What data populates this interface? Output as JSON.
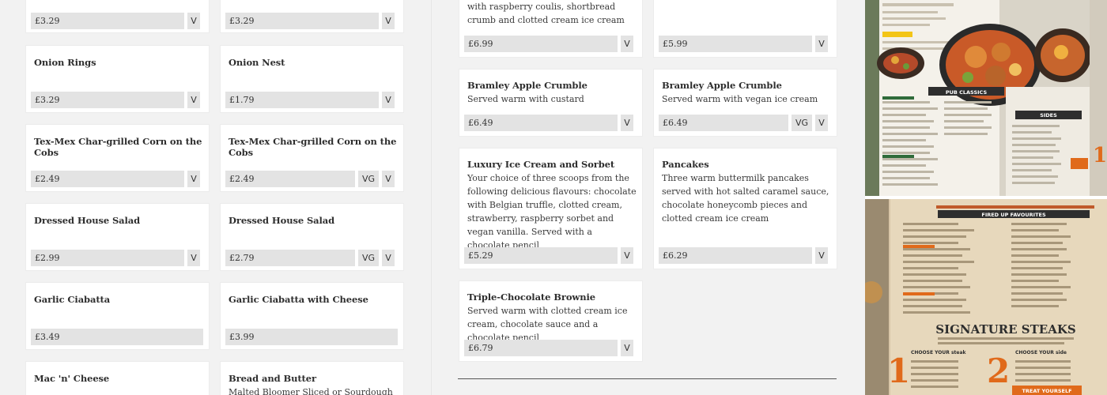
{
  "left_menu": {
    "cards": [
      {
        "title": "",
        "price": "£3.29",
        "tags": [
          "V"
        ]
      },
      {
        "title": "",
        "price": "£3.29",
        "tags": [
          "V"
        ]
      },
      {
        "title": "Onion Rings",
        "price": "£3.29",
        "tags": [
          "V"
        ]
      },
      {
        "title": "Onion Nest",
        "price": "£1.79",
        "tags": [
          "V"
        ]
      },
      {
        "title": "Tex-Mex Char-grilled Corn on the Cobs",
        "price": "£2.49",
        "tags": [
          "V"
        ]
      },
      {
        "title": "Tex-Mex Char-grilled Corn on the Cobs",
        "price": "£2.49",
        "tags": [
          "VG",
          "V"
        ]
      },
      {
        "title": "Dressed House Salad",
        "price": "£2.99",
        "tags": [
          "V"
        ]
      },
      {
        "title": "Dressed House Salad",
        "price": "£2.79",
        "tags": [
          "VG",
          "V"
        ]
      },
      {
        "title": "Garlic Ciabatta",
        "price": "£3.49",
        "tags": []
      },
      {
        "title": "Garlic Ciabatta with Cheese",
        "price": "£3.99",
        "tags": []
      },
      {
        "title": "Mac 'n' Cheese",
        "price": "",
        "tags": []
      },
      {
        "title": "Bread and Butter",
        "desc": "Malted Bloomer Sliced or Sourdough",
        "price": "",
        "tags": []
      }
    ]
  },
  "mid_menu": {
    "cards": [
      {
        "title": "",
        "desc": "with raspberry coulis, shortbread crumb and clotted cream ice cream",
        "price": "£6.99",
        "tags": [
          "V"
        ]
      },
      {
        "title": "",
        "desc": "",
        "price": "£5.99",
        "tags": [
          "V"
        ]
      },
      {
        "title": "Bramley Apple Crumble",
        "desc": "Served warm with custard",
        "price": "£6.49",
        "tags": [
          "V"
        ]
      },
      {
        "title": "Bramley Apple Crumble",
        "desc": "Served warm with vegan ice cream",
        "price": "£6.49",
        "tags": [
          "VG",
          "V"
        ]
      },
      {
        "title": "Luxury Ice Cream and Sorbet",
        "desc": "Your choice of three scoops from the following delicious flavours: chocolate with Belgian truffle, clotted cream, strawberry, raspberry sorbet and vegan vanilla. Served with a chocolate pencil",
        "price": "£5.29",
        "tags": [
          "V"
        ]
      },
      {
        "title": "Pancakes",
        "desc": "Three warm buttermilk pancakes served with hot salted caramel sauce, chocolate honeycomb pieces and clotted cream ice cream",
        "price": "£6.29",
        "tags": [
          "V"
        ]
      },
      {
        "title": "Triple-Chocolate Brownie",
        "desc": "Served warm with clotted cream ice cream, chocolate sauce and a chocolate pencil",
        "price": "£6.79",
        "tags": [
          "V"
        ]
      }
    ]
  },
  "photos": {
    "top": {
      "label_pub": "PUB CLASSICS",
      "label_sides": "SIDES"
    },
    "bottom": {
      "label_fired": "FIRED UP FAVOURITES",
      "label_steaks": "SIGNATURE STEAKS",
      "label_treat": "TREAT YOURSELF",
      "num1": "1",
      "num2": "2",
      "choose_steak": "CHOOSE YOUR steak",
      "choose_side": "CHOOSE YOUR side"
    }
  },
  "colors": {
    "page_bg": "#f2f2f2",
    "card_bg": "#ffffff",
    "price_bg": "#e3e3e3",
    "menu_green": "#2f6b3a",
    "menu_orange": "#e06a1b"
  }
}
